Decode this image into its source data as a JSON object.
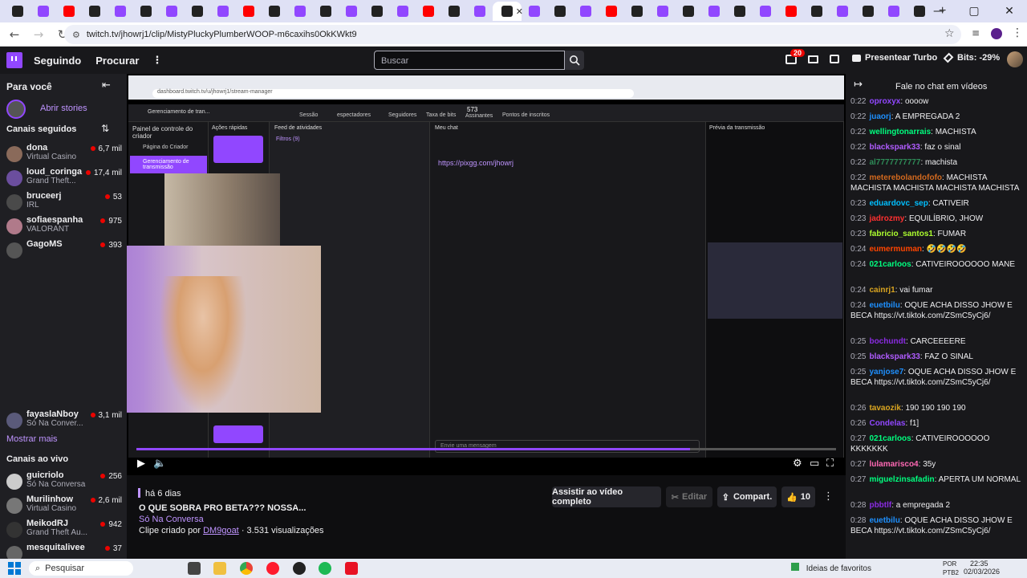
{
  "browser": {
    "url": "twitch.tv/jhowrj1/clip/MistyPluckyPlumberWOOP-m6caxihs0OkKWkt9",
    "tab_count": 36
  },
  "nav": {
    "following": "Seguindo",
    "browse": "Procurar",
    "search_placeholder": "Buscar",
    "notif_badge": "20",
    "turbo": "Presentear Turbo",
    "bits": "Bits: -29%"
  },
  "sidebar": {
    "for_you": "Para você",
    "open_stories": "Abrir stories",
    "followed_header": "Canais seguidos",
    "channels": [
      {
        "name": "dona",
        "game": "Virtual Casino",
        "viewers": "6,7 mil",
        "color": "#8a6a5a"
      },
      {
        "name": "loud_coringa",
        "game": "Grand Theft...",
        "viewers": "17,4 mil",
        "color": "#6b4e9e"
      },
      {
        "name": "bruceerj",
        "game": "IRL",
        "viewers": "53",
        "color": "#4a4a4a"
      },
      {
        "name": "sofiaespanha",
        "game": "VALORANT",
        "viewers": "975",
        "color": "#b07a8a"
      },
      {
        "name": "GagoMS",
        "game": "",
        "viewers": "393",
        "color": "#555"
      }
    ],
    "last_channel": {
      "name": "fayaslaNboy",
      "game": "Só Na Conver...",
      "viewers": "3,1 mil"
    },
    "show_more": "Mostrar mais",
    "live_header": "Canais ao vivo",
    "live_channels": [
      {
        "name": "guicriolo",
        "game": "Só Na Conversa",
        "viewers": "256",
        "color": "#ccc"
      },
      {
        "name": "Murilinhow",
        "game": "Virtual Casino",
        "viewers": "2,6 mil",
        "color": "#777"
      },
      {
        "name": "MeikodRJ",
        "game": "Grand Theft Au...",
        "viewers": "942",
        "color": "#333"
      },
      {
        "name": "mesquitalivee",
        "game": "",
        "viewers": "37",
        "color": "#666"
      }
    ]
  },
  "video": {
    "inner_url": "dashboard.twitch.tv/u/jhowrj1/stream-manager",
    "dashboard_title": "Gerenciamento de tran...",
    "panel_title": "Painel de controle do criador",
    "creator_page": "Página do Criador",
    "stream_mgmt": "Gerenciamento de transmissão",
    "quick_actions": "Ações rápidas",
    "activity_feed": "Feed de atividades",
    "my_chat": "Meu chat",
    "preview": "Prévia da transmissão",
    "stats": {
      "session": "Sessão",
      "viewers": "espectadores",
      "followers": "Seguidores",
      "bits": "Taxa de bits",
      "subs": "Assinantes",
      "subs_count": "573",
      "points": "Pontos de inscritos"
    },
    "filters": "Filtros (9)",
    "pinned_link": "https://pixgg.com/jhowrj",
    "send_message": "Envie uma mensagem"
  },
  "clip": {
    "age": "há 6 dias",
    "title": "O QUE SOBRA PRO BETA??? NOSSA...",
    "category": "Só Na Conversa",
    "created_by": "Clipe criado por",
    "creator": "DM9goat",
    "views": "3.531 visualizações",
    "watch_full": "Assistir ao vídeo completo",
    "edit": "Editar",
    "share": "Compart.",
    "likes": "10"
  },
  "chat": {
    "header": "Fale no chat em vídeos",
    "messages": [
      {
        "time": "0:22",
        "user": "oproxyx",
        "color": "#9147ff",
        "text": "oooow"
      },
      {
        "time": "0:22",
        "user": "juaorj",
        "color": "#1e90ff",
        "text": "A EMPREGADA 2"
      },
      {
        "time": "0:22",
        "user": "wellingtonarrais",
        "color": "#00ff7f",
        "text": "MACHISTA"
      },
      {
        "time": "0:22",
        "user": "blackspark33",
        "color": "#b05cff",
        "text": "faz o sinal"
      },
      {
        "time": "0:22",
        "user": "al7777777777",
        "color": "#2e8b57",
        "text": "machista"
      },
      {
        "time": "0:22",
        "user": "meterebolandofofo",
        "color": "#d2691e",
        "text": "MACHISTA MACHISTA MACHISTA MACHISTA MACHISTA"
      },
      {
        "time": "0:23",
        "user": "eduardovc_sep",
        "color": "#00bfff",
        "text": "CATIVEIR"
      },
      {
        "time": "0:23",
        "user": "jadrozmy",
        "color": "#ff3030",
        "text": "EQUILÍBRIO, JHOW"
      },
      {
        "time": "0:23",
        "user": "fabricio_santos1",
        "color": "#adff2f",
        "text": "FUMAR"
      },
      {
        "time": "0:24",
        "user": "eumermuman",
        "color": "#ff4500",
        "text": "🤣🤣🤣🤣"
      },
      {
        "time": "0:24",
        "user": "021carloos",
        "color": "#00ff7f",
        "text": "CATIVEIROOOOOO MANE"
      },
      {
        "time": "0:24",
        "user": "cainrj1",
        "color": "#daa520",
        "text": "vai fumar"
      },
      {
        "time": "0:24",
        "user": "euetbilu",
        "color": "#1e90ff",
        "text": "OQUE ACHA DISSO JHOW E BECA https://vt.tiktok.com/ZSmC5yCj6/"
      },
      {
        "time": "0:25",
        "user": "bochundt",
        "color": "#8a2be2",
        "text": "CARCEEEERE"
      },
      {
        "time": "0:25",
        "user": "blackspark33",
        "color": "#b05cff",
        "text": "FAZ O SINAL"
      },
      {
        "time": "0:25",
        "user": "yanjose7",
        "color": "#1e90ff",
        "text": "OQUE ACHA DISSO JHOW E BECA https://vt.tiktok.com/ZSmC5yCj6/"
      },
      {
        "time": "0:26",
        "user": "tavaozik",
        "color": "#daa520",
        "text": "190 190 190 190"
      },
      {
        "time": "0:26",
        "user": "Condelas",
        "color": "#9147ff",
        "text": "f1]"
      },
      {
        "time": "0:27",
        "user": "021carloos",
        "color": "#00ff7f",
        "text": "CATIVEIROOOOOO KKKKKKK"
      },
      {
        "time": "0:27",
        "user": "lulamarisco4",
        "color": "#ff69b4",
        "text": "35y"
      },
      {
        "time": "0:27",
        "user": "miguelzinsafadin",
        "color": "#00ff7f",
        "text": "APERTA UM NORMAL"
      },
      {
        "time": "0:28",
        "user": "pbbtlf",
        "color": "#8a2be2",
        "text": "a empregada 2"
      },
      {
        "time": "0:28",
        "user": "euetbilu",
        "color": "#1e90ff",
        "text": "OQUE ACHA DISSO JHOW E BECA https://vt.tiktok.com/ZSmC5yCj6/"
      }
    ]
  },
  "taskbar": {
    "search": "Pesquisar",
    "news": "Ideias de favoritos",
    "lang": "POR PTB2",
    "time": "22:35",
    "date": "02/03/2026"
  }
}
